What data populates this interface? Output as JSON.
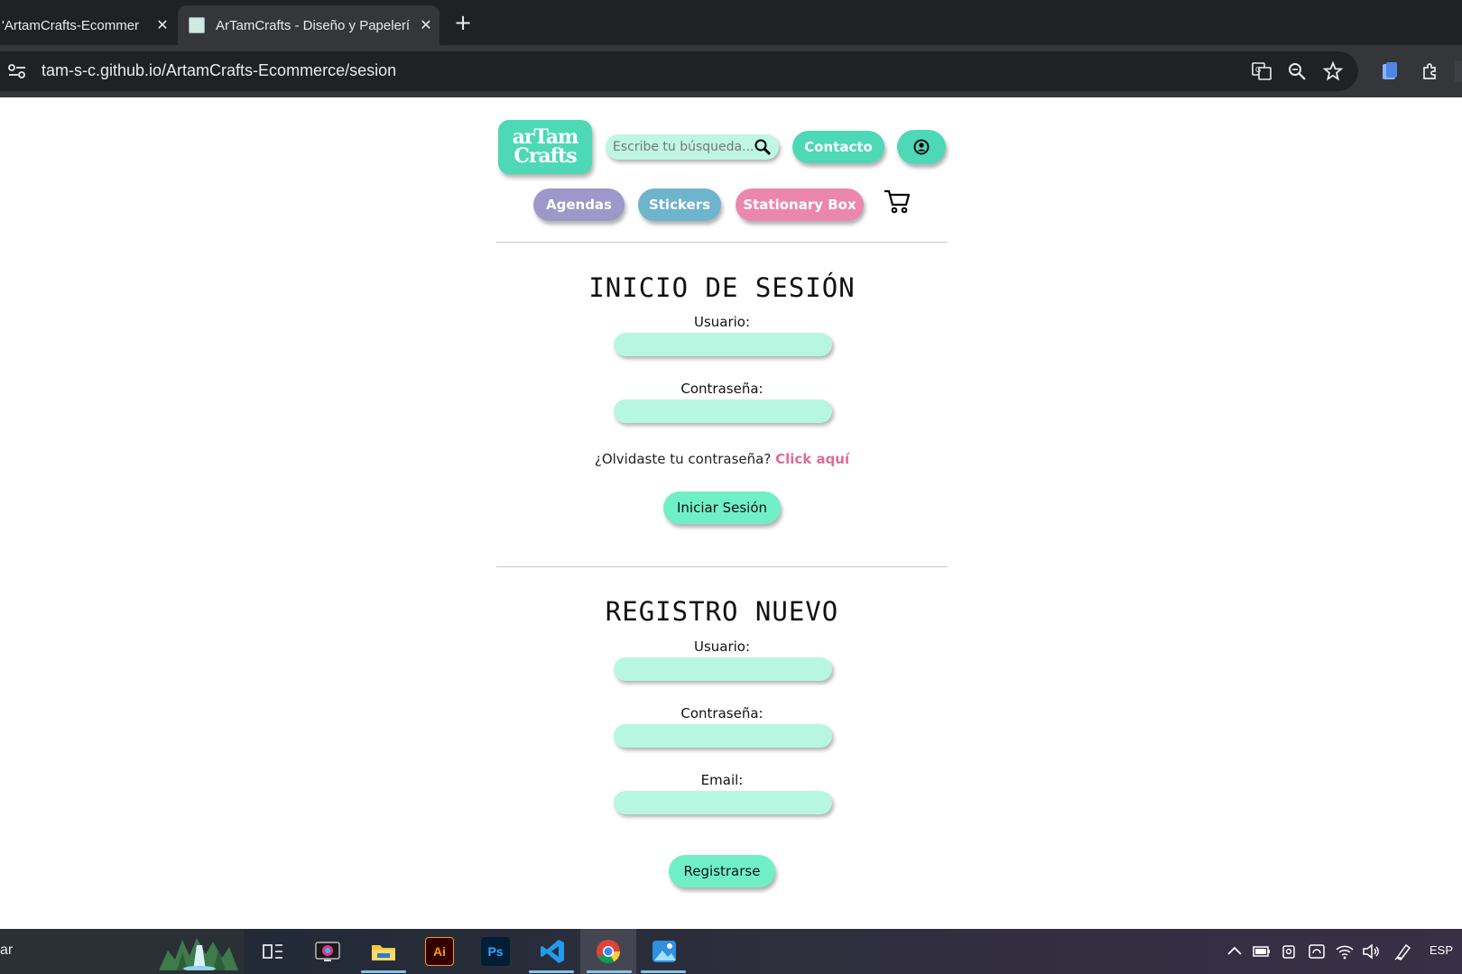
{
  "browser": {
    "tabs": [
      {
        "title": "'ArtamCrafts-Ecommer",
        "active": false
      },
      {
        "title": "ArTamCrafts - Diseño y Papelerí",
        "active": true
      }
    ],
    "close_glyph": "✕",
    "new_tab_glyph": "+",
    "url": "tam-s-c.github.io/ArtamCrafts-Ecommerce/sesion",
    "icons": [
      "site-settings-icon",
      "translate-icon",
      "zoom-icon",
      "bookmark-star-icon",
      "side-panel-icon",
      "extensions-icon"
    ]
  },
  "header": {
    "logo": {
      "line1": "arTam",
      "line2": "Crafts"
    },
    "search_placeholder": "Escribe tu búsqueda...",
    "contact_label": "Contacto",
    "categories": [
      "Agendas",
      "Stickers",
      "Stationary Box"
    ],
    "colors": {
      "primary": "#4dd8b6",
      "agendas": "#9e97c9",
      "stickers": "#6eb4cc",
      "stationary": "#ec87ac"
    }
  },
  "login": {
    "title": "INICIO DE SESIÓN",
    "user_label": "Usuario:",
    "password_label": "Contraseña:",
    "forgot_text": "¿Olvidaste tu contraseña?",
    "forgot_link": "Click aquí",
    "submit_label": "Iniciar Sesión"
  },
  "register": {
    "title": "REGISTRO NUEVO",
    "user_label": "Usuario:",
    "password_label": "Contraseña:",
    "email_label": "Email:",
    "submit_label": "Registrarse"
  },
  "taskbar": {
    "search_text": "ar",
    "apps": [
      "task-view-icon",
      "media-app-icon",
      "file-explorer-icon",
      "illustrator-icon",
      "photoshop-icon",
      "vscode-icon",
      "chrome-icon",
      "photos-icon"
    ],
    "illustrator_label": "Ai",
    "photoshop_label": "Ps",
    "language": "ESP"
  }
}
